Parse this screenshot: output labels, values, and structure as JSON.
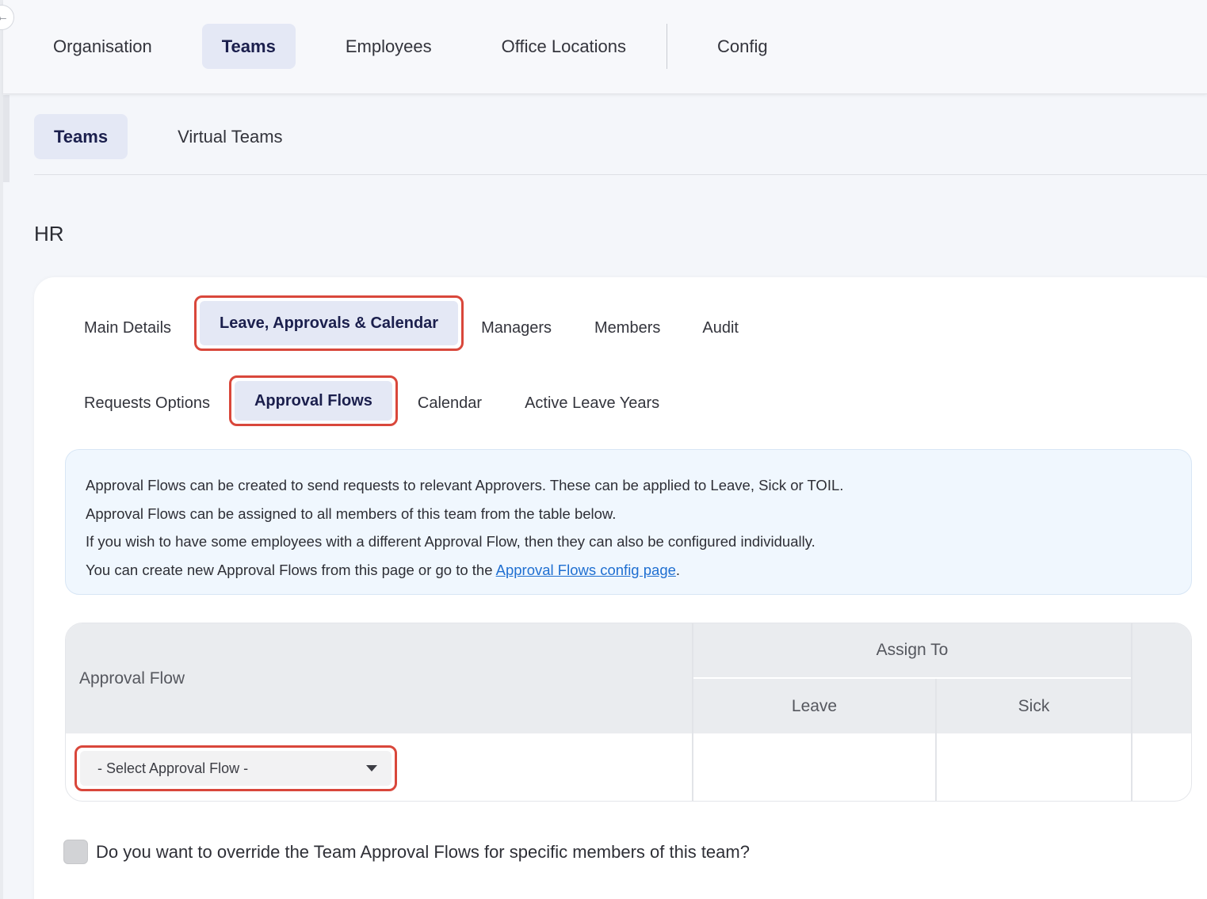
{
  "top_nav": {
    "items": [
      {
        "label": "Organisation",
        "active": false
      },
      {
        "label": "Teams",
        "active": true
      },
      {
        "label": "Employees",
        "active": false
      },
      {
        "label": "Office Locations",
        "active": false
      }
    ],
    "config_label": "Config"
  },
  "sub_nav": {
    "items": [
      {
        "label": "Teams",
        "active": true
      },
      {
        "label": "Virtual Teams",
        "active": false
      }
    ]
  },
  "page": {
    "title": "HR"
  },
  "team_tabs": {
    "main_details": "Main Details",
    "leave_approvals_calendar": "Leave, Approvals & Calendar",
    "managers": "Managers",
    "members": "Members",
    "audit": "Audit",
    "active": "Leave, Approvals & Calendar"
  },
  "leave_tabs": {
    "requests_options": "Requests Options",
    "approval_flows": "Approval Flows",
    "calendar": "Calendar",
    "active_leave_years": "Active Leave Years",
    "active": "Approval Flows"
  },
  "info": {
    "line1": "Approval Flows can be created to send requests to relevant Approvers. These can be applied to Leave, Sick or TOIL.",
    "line2": "Approval Flows can be assigned to all members of this team from the table below.",
    "line3": "If you wish to have some employees with a different Approval Flow, then they can also be configured individually.",
    "line4_prefix": "You can create new Approval Flows from this page or go to the ",
    "line4_link": "Approval Flows config page",
    "line4_suffix": "."
  },
  "table": {
    "header_flow": "Approval Flow",
    "header_assign": "Assign To",
    "header_leave": "Leave",
    "header_sick": "Sick",
    "select_value": "- Select Approval Flow -"
  },
  "override": {
    "label": "Do you want to override the Team Approval Flows for specific members of this team?",
    "checked": false
  },
  "colors": {
    "active_tab_bg": "#e4e8f5",
    "highlight_border": "#d9473b",
    "info_bg": "#f0f7fe",
    "link": "#1f6fd1"
  }
}
